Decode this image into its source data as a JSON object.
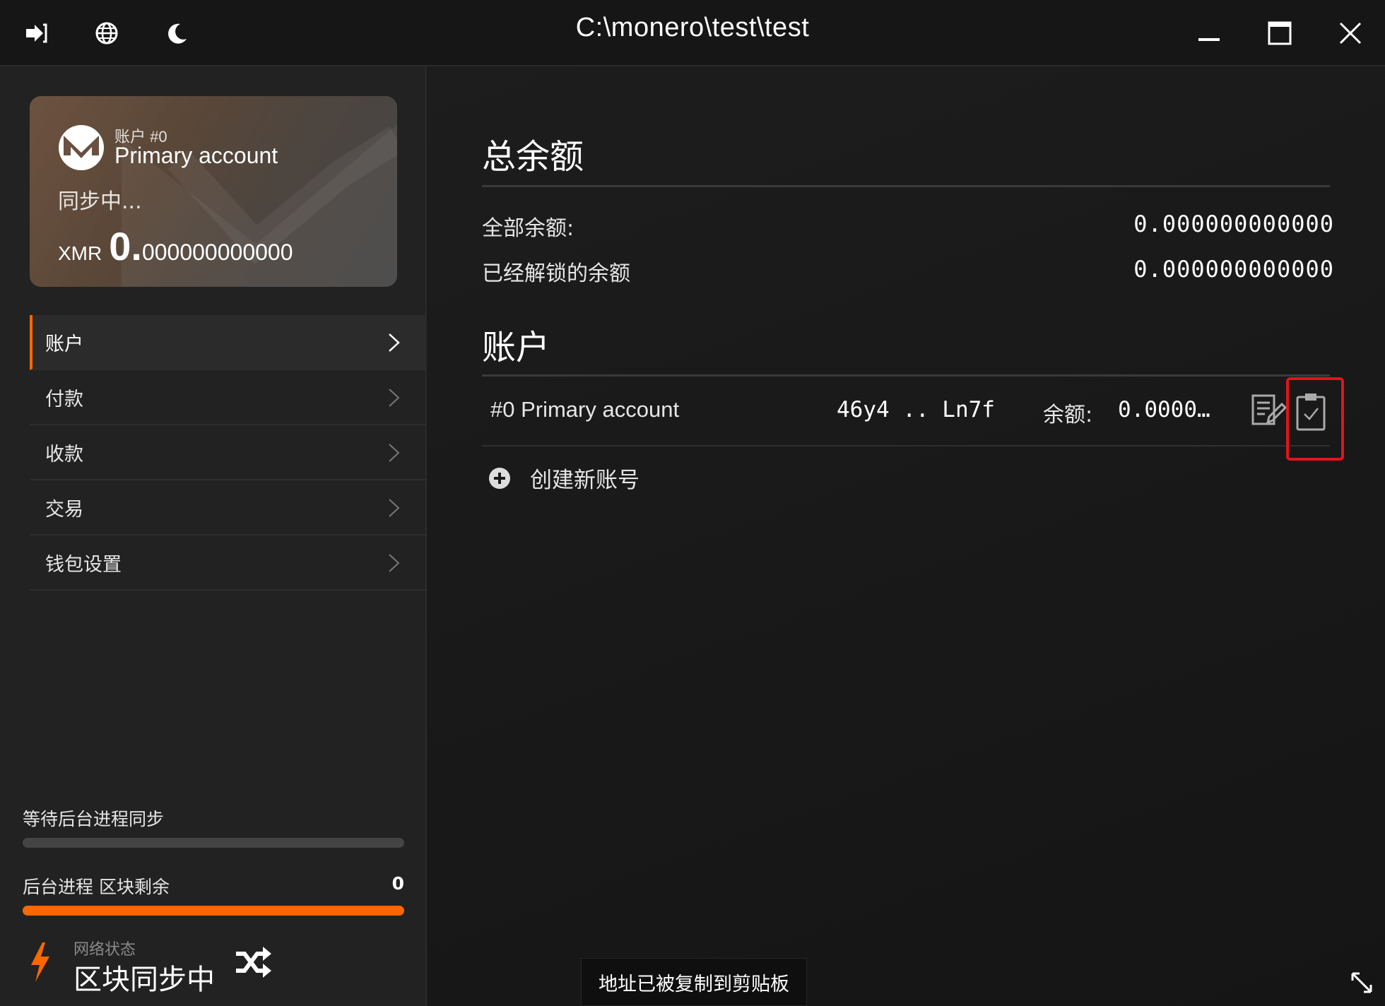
{
  "titlebar": {
    "title": "C:\\monero\\test\\test",
    "icons": [
      "logout-icon",
      "globe-icon",
      "moon-icon",
      "minimize-icon",
      "maximize-icon",
      "close-icon"
    ]
  },
  "card": {
    "account_small": "账户 #0",
    "account_name": "Primary account",
    "sync_text": "同步中...",
    "currency": "XMR",
    "balance_int": "0.",
    "balance_frac": "000000000000"
  },
  "nav": {
    "items": [
      {
        "label": "账户",
        "active": true
      },
      {
        "label": "付款",
        "active": false
      },
      {
        "label": "收款",
        "active": false
      },
      {
        "label": "交易",
        "active": false
      },
      {
        "label": "钱包设置",
        "active": false
      }
    ]
  },
  "progress": {
    "wait_label": "等待后台进程同步",
    "wait_fraction": 0.0,
    "daemon_label": "后台进程 区块剩余",
    "daemon_count": "0",
    "daemon_fraction": 1.0
  },
  "network": {
    "label": "网络状态",
    "status": "区块同步中"
  },
  "main": {
    "total_heading": "总余额",
    "total_balance_label": "全部余额:",
    "total_balance_value": "0.000000000000",
    "unlocked_label": "已经解锁的余额",
    "unlocked_value": "0.000000000000",
    "accounts_heading": "账户",
    "account_row": {
      "name": "#0 Primary account",
      "address": "46y4 .. Ln7f",
      "balance_label": "余额:",
      "balance": "0.0000…"
    },
    "create_label": "创建新账号"
  },
  "toast": {
    "message": "地址已被复制到剪贴板"
  },
  "colors": {
    "accent": "#fa6800",
    "highlight": "#e0151b"
  }
}
